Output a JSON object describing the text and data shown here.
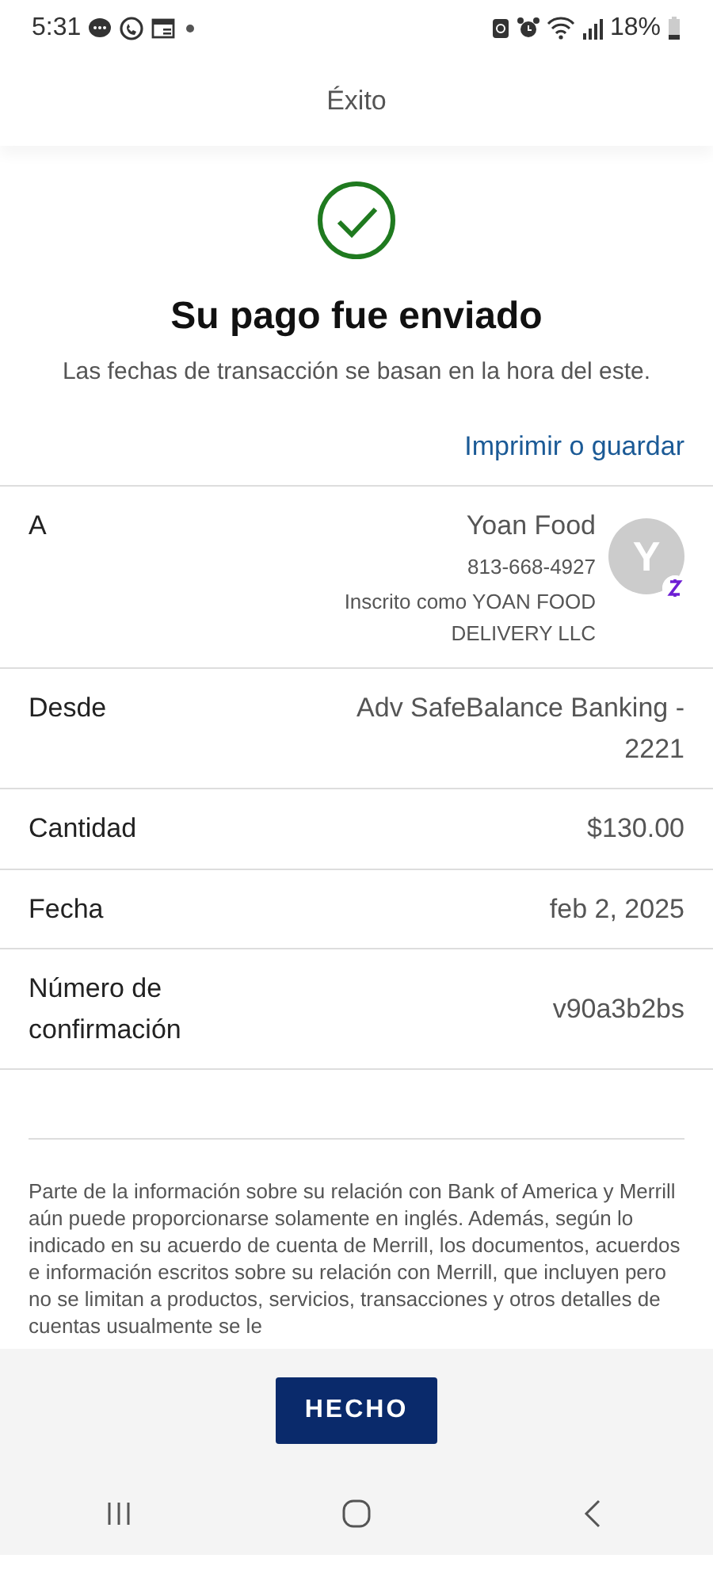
{
  "status_bar": {
    "time": "5:31",
    "battery": "18%"
  },
  "header": {
    "title": "Éxito"
  },
  "success": {
    "title": "Su pago fue enviado",
    "subtitle": "Las fechas de transacción se basan en la hora del este.",
    "link": "Imprimir o guardar"
  },
  "details": [
    {
      "kind": "recipient",
      "label": "A",
      "value": "Yoan Food",
      "lines": [
        "813-668-4927",
        "Inscrito como YOAN FOOD DELIVERY LLC"
      ],
      "avatar": "Y"
    },
    {
      "kind": "plain",
      "label": "Desde",
      "value": "Adv SafeBalance Banking - 2221"
    },
    {
      "kind": "plain",
      "label": "Cantidad",
      "value": "$130.00"
    },
    {
      "kind": "plain",
      "label": "Fecha",
      "value": "feb 2, 2025"
    },
    {
      "kind": "plain",
      "label": "Número de confirmación",
      "value": "v90a3b2bs"
    }
  ],
  "disclaimer": "Parte de la información sobre su relación con Bank of America y Merrill aún puede proporcionarse solamente en inglés. Además, según lo indicado en su acuerdo de cuenta de Merrill, los documentos, acuerdos e información escritos sobre su relación con Merrill, que incluyen pero no se limitan a productos, servicios, transacciones y otros detalles de cuentas usualmente se le",
  "footer": {
    "button": "HECHO"
  }
}
